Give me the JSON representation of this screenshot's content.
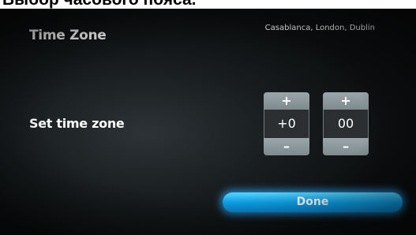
{
  "caption": "Выбор часового пояса.",
  "screen": {
    "title": "Time Zone",
    "zone_name": "Casablanca, London, Dublin",
    "set_label": "Set time zone",
    "hours": {
      "plus": "+",
      "value": "+0",
      "minus": "–"
    },
    "minutes": {
      "plus": "+",
      "value": "00",
      "minus": "–"
    },
    "done_label": "Done"
  },
  "colors": {
    "accent": "#1aaff0",
    "spinner_button": "#8c979c",
    "background": "#181c1e"
  }
}
